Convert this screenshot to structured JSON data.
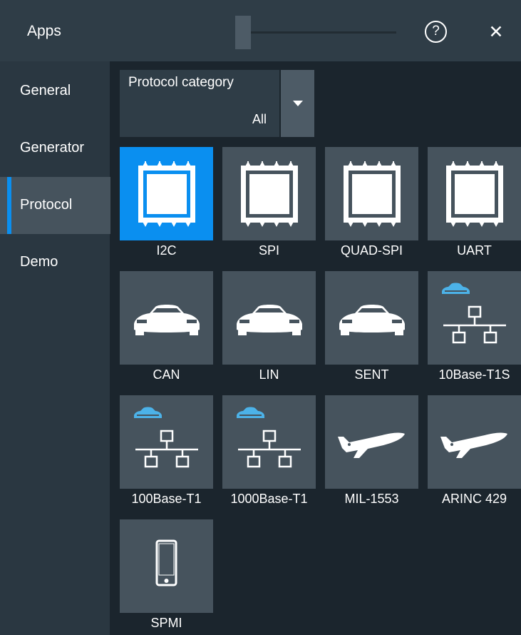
{
  "header": {
    "title": "Apps",
    "help_label": "?",
    "close_label": "✕"
  },
  "sidebar": {
    "items": [
      {
        "label": "General"
      },
      {
        "label": "Generator"
      },
      {
        "label": "Protocol",
        "active": true
      },
      {
        "label": "Demo"
      }
    ]
  },
  "filter": {
    "label": "Protocol category",
    "value": "All"
  },
  "apps": [
    {
      "label": "I2C",
      "icon": "chip-icon",
      "selected": true
    },
    {
      "label": "SPI",
      "icon": "chip-icon"
    },
    {
      "label": "QUAD-SPI",
      "icon": "chip-icon"
    },
    {
      "label": "UART",
      "icon": "chip-icon"
    },
    {
      "label": "CAN",
      "icon": "car-icon"
    },
    {
      "label": "LIN",
      "icon": "car-icon"
    },
    {
      "label": "SENT",
      "icon": "car-icon"
    },
    {
      "label": "10Base-T1S",
      "icon": "automotive-network-icon"
    },
    {
      "label": "100Base-T1",
      "icon": "automotive-network-icon"
    },
    {
      "label": "1000Base-T1",
      "icon": "automotive-network-icon"
    },
    {
      "label": "MIL-1553",
      "icon": "airplane-icon"
    },
    {
      "label": "ARINC 429",
      "icon": "airplane-icon"
    },
    {
      "label": "SPMI",
      "icon": "mobile-device-icon"
    }
  ],
  "colors": {
    "accent": "#0a8ff0",
    "tile": "#46535d",
    "header": "#2f3d47",
    "background": "#1b252d"
  }
}
